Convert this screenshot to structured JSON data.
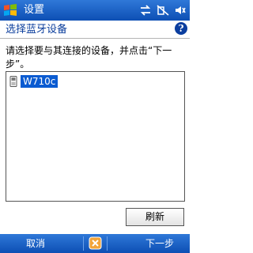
{
  "titlebar": {
    "title": "设置",
    "start_icon": "windows-flag-icon",
    "status_icons": [
      "connectivity-icon",
      "signal-off-icon",
      "volume-icon"
    ]
  },
  "header": {
    "title": "选择蓝牙设备",
    "help_icon": "help-icon"
  },
  "instruction": "请选择要与其连接的设备，并点击“下一步”。",
  "devices": [
    {
      "name": "W710c",
      "icon": "phone-icon",
      "selected": true
    }
  ],
  "buttons": {
    "refresh": "刷新"
  },
  "softkeys": {
    "left": "取消",
    "right": "下一步",
    "center_icon": "keyboard-sip-icon"
  },
  "colors": {
    "bar_blue": "#0d4fb4",
    "title_blue": "#0a3d9c",
    "selection": "#0a5bd1"
  }
}
